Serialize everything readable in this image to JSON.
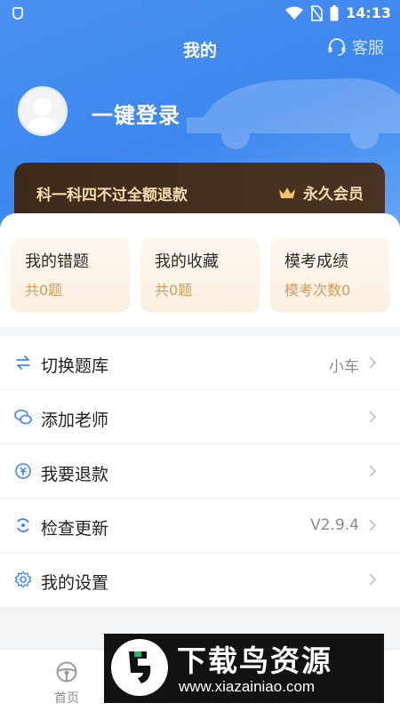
{
  "status_bar": {
    "time": "14:13"
  },
  "header": {
    "title": "我的",
    "service_label": "客服"
  },
  "user": {
    "login_label": "一键登录"
  },
  "vip_banner": {
    "promo_text": "科一科四不过全额退款",
    "member_label": "永久会员"
  },
  "stats_cards": [
    {
      "title": "我的错题",
      "subtitle": "共0题"
    },
    {
      "title": "我的收藏",
      "subtitle": "共0题"
    },
    {
      "title": "模考成绩",
      "subtitle": "模考次数0"
    }
  ],
  "menu": [
    {
      "label": "切换题库",
      "value": "小车",
      "icon": "switch-icon"
    },
    {
      "label": "添加老师",
      "value": "",
      "icon": "wechat-icon"
    },
    {
      "label": "我要退款",
      "value": "",
      "icon": "refund-icon"
    },
    {
      "label": "检查更新",
      "value": "V2.9.4",
      "icon": "refresh-icon"
    },
    {
      "label": "我的设置",
      "value": "",
      "icon": "gear-icon"
    }
  ],
  "tabbar": {
    "home_label": "首页"
  },
  "watermark": {
    "title": "下载鸟资源",
    "url": "www.xiazainiao.com"
  },
  "colors": {
    "header_blue": "#3d86ee",
    "vip_dark": "#3e2a1b",
    "vip_gold": "#f5dcb0",
    "card_accent": "#d49d57",
    "icon_blue": "#3d86ee"
  }
}
